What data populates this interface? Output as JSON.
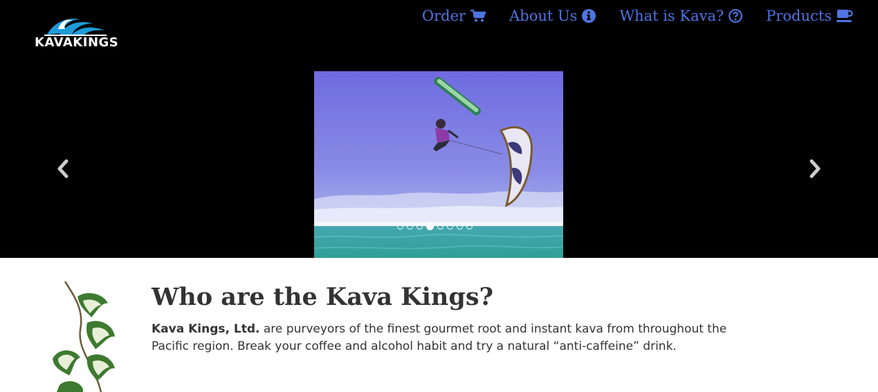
{
  "brand": {
    "logo_text": "KAVAKINGS"
  },
  "nav": {
    "items": [
      {
        "label": "Order",
        "icon": "cart-icon"
      },
      {
        "label": "About Us",
        "icon": "info-icon"
      },
      {
        "label": "What is Kava?",
        "icon": "question-icon"
      },
      {
        "label": "Products",
        "icon": "coffee-cup-icon"
      }
    ]
  },
  "carousel": {
    "slide_count": 8,
    "active_index": 3,
    "slide_subject": "kiteboarder",
    "prev_icon": "chevron-left-icon",
    "next_icon": "chevron-right-icon"
  },
  "intro": {
    "heading": "Who are the Kava Kings?",
    "company_name": "Kava Kings, Ltd.",
    "body": " are purveyors of the finest gourmet root and instant kava from throughout the Pacific region. Break your coffee and alcohol habit and try a natural “anti-caffeine” drink."
  },
  "colors": {
    "nav_link": "#4f74e3",
    "hero_bg": "#000000",
    "text": "#333333"
  }
}
